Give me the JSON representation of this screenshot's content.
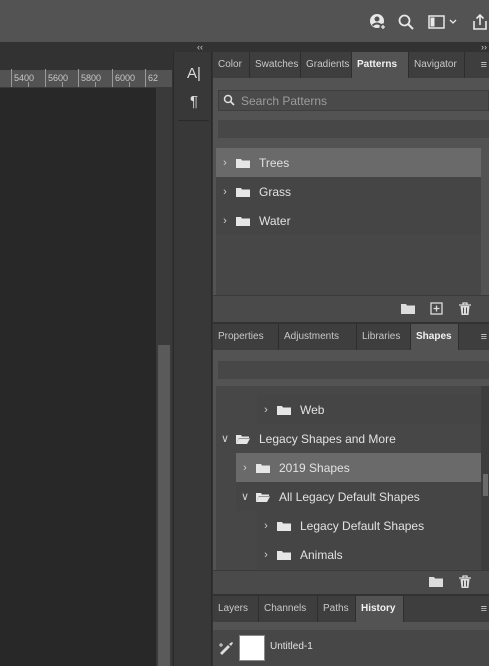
{
  "ruler": {
    "ticks": [
      "5400",
      "5600",
      "5800",
      "6000",
      "62"
    ]
  },
  "patterns_panel": {
    "tabs": [
      "Color",
      "Swatches",
      "Gradients",
      "Patterns",
      "Navigator"
    ],
    "active_tab": "Patterns",
    "search_placeholder": "Search Patterns",
    "items": [
      "Trees",
      "Grass",
      "Water"
    ]
  },
  "shapes_panel": {
    "tabs": [
      "Properties",
      "Adjustments",
      "Libraries",
      "Shapes"
    ],
    "active_tab": "Shapes",
    "items": [
      "Web",
      "Legacy Shapes and More",
      "2019 Shapes",
      "All Legacy Default Shapes",
      "Legacy Default Shapes",
      "Animals"
    ]
  },
  "history_panel": {
    "tabs": [
      "Layers",
      "Channels",
      "Paths",
      "History"
    ],
    "active_tab": "History",
    "snapshot_label": "Untitled-1"
  },
  "icons": {
    "top": [
      "user-icon",
      "search-icon",
      "workspace-icon",
      "share-icon"
    ],
    "tools": [
      "character-icon",
      "paragraph-icon"
    ]
  }
}
